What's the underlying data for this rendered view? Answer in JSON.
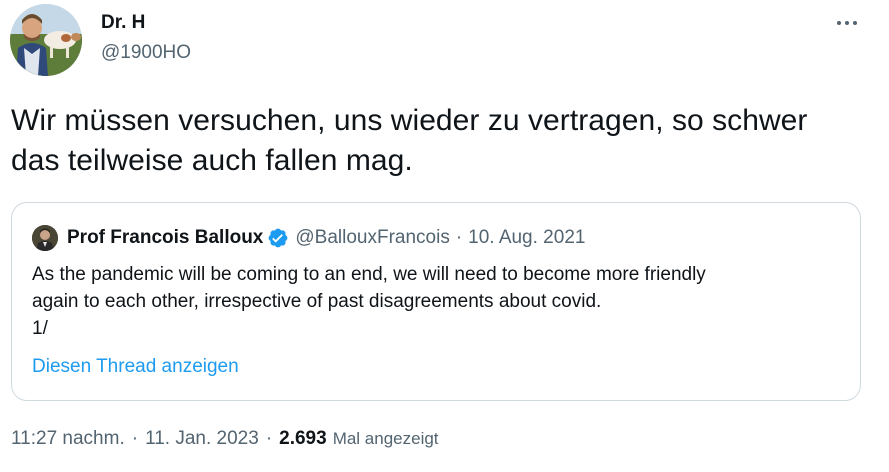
{
  "author": {
    "name": "Dr. H",
    "handle": "@1900HO"
  },
  "tweet": {
    "text": "Wir müssen versuchen, uns wieder zu vertragen, so schwer das teilweise auch fallen mag."
  },
  "quote": {
    "name": "Prof Francois Balloux",
    "handle": "@BallouxFrancois",
    "separator": "·",
    "date": "10. Aug. 2021",
    "lines": [
      "As the pandemic will be coming to an end, we will need to become more friendly",
      "again to each other, irrespective of past disagreements about covid.",
      "1/"
    ],
    "thread_link": "Diesen Thread anzeigen"
  },
  "meta": {
    "time": "11:27 nachm.",
    "separator": "·",
    "date": "11. Jan. 2023",
    "views_count": "2.693",
    "views_label": "Mal angezeigt"
  },
  "icons": {
    "more": "more-horizontal-icon",
    "verified": "verified-badge-icon"
  },
  "colors": {
    "text": "#0f1419",
    "secondary": "#536471",
    "link": "#1d9bf0",
    "border": "#cfd9de"
  }
}
